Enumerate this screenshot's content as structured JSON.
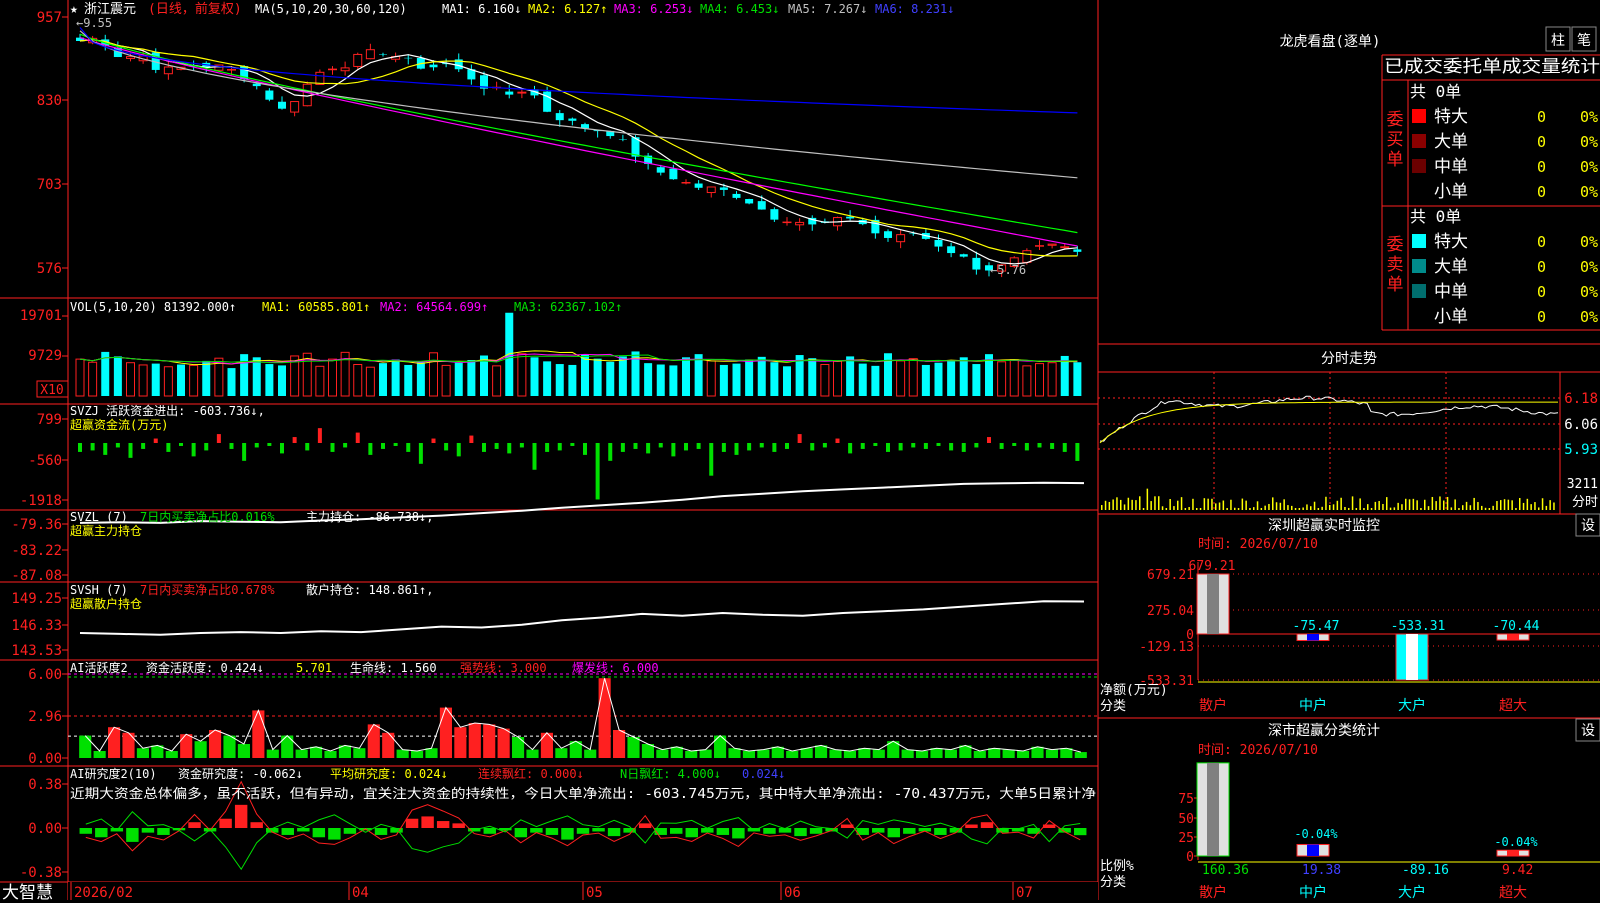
{
  "app": {
    "brand": "大智慧",
    "mode": "超赢"
  },
  "main_panel": {
    "star": "★",
    "stock": "浙江震元",
    "period": "(日线，前复权)",
    "ma_label": "MA(5,10,20,30,60,120)",
    "ma1": "MA1: 6.160↓",
    "ma2": "MA2: 6.127↑",
    "ma3": "MA3: 6.253↓",
    "ma4": "MA4: 6.453↓",
    "ma5": "MA5: 7.267↓",
    "ma6": "MA6: 8.231↓",
    "y_ticks": [
      "957",
      "830",
      "703",
      "576"
    ],
    "high_label": "←9.55",
    "low_label": "←5.76"
  },
  "vol_panel": {
    "title": "VOL(5,10,20)  81392.000↑",
    "ma1": "MA1: 60585.801↑",
    "ma2": "MA2: 64564.699↑",
    "ma3": "MA3: 62367.102↑",
    "y_ticks": [
      "19701",
      "9729"
    ],
    "unit": "X10"
  },
  "svzj_panel": {
    "title": "SVZJ  活跃资金进出: -603.736↓,",
    "subtitle": "超赢资金流(万元)",
    "y_ticks": [
      "799",
      "-560",
      "-1918"
    ]
  },
  "svzl_panel": {
    "title": "SVZL (7)",
    "ratio": "7日内买卖净占比0.016%",
    "hold": "主力持仓: -86.738↓,",
    "subtitle": "超赢主力持仓",
    "y_ticks": [
      "-79.36",
      "-83.22",
      "-87.08"
    ]
  },
  "svsh_panel": {
    "title": "SVSH (7)",
    "ratio": "7日内买卖净占比0.678%",
    "hold": "散户持仓: 148.861↑,",
    "subtitle": "超赢散户持仓",
    "y_ticks": [
      "149.25",
      "146.33",
      "143.53"
    ]
  },
  "ai_active_panel": {
    "title": "AI活跃度2",
    "v1": "资金活跃度: 0.424↓",
    "v2": "5.701",
    "v3": "生命线: 1.560",
    "v4": "强势线: 3.000",
    "v5": "爆发线: 6.000",
    "y_ticks": [
      "6.00",
      "2.96",
      "0.00"
    ]
  },
  "ai_research_panel": {
    "title": "AI研究度2(10)",
    "v1": "资金研究度: -0.062↓",
    "v2": "平均研究度: 0.024↓",
    "v3": "连续飘红: 0.000↓",
    "v4": "N日飘红: 4.000↓",
    "v5": "0.024↓",
    "comment": "近期大资金总体偏多，虽不活跃，但有异动，宜关注大资金的持续性，今日大单净流出: -603.745万元，其中特大单净流出: -70.437万元，大单5日累计净",
    "y_ticks": [
      "0.38",
      "0.00",
      "-0.38"
    ]
  },
  "x_axis": [
    "2026/02",
    "04",
    "05",
    "06",
    "07"
  ],
  "dragon_tiger": {
    "title": "龙虎看盘(逐单)",
    "btn_bar": "柱",
    "btn_stroke": "笔",
    "stats_title": "已成交委托单成交量统计",
    "buy_label": "委买单",
    "sell_label": "委卖单",
    "buy_total": "共 0单",
    "sell_total": "共 0单",
    "buy_rows": [
      {
        "name": "特大",
        "count": "0",
        "pct": "0%",
        "color": "#ff0000"
      },
      {
        "name": "大单",
        "count": "0",
        "pct": "0%",
        "color": "#8b0000"
      },
      {
        "name": "中单",
        "count": "0",
        "pct": "0%",
        "color": "#6b0000"
      },
      {
        "name": "小单",
        "count": "0",
        "pct": "0%",
        "color": ""
      }
    ],
    "sell_rows": [
      {
        "name": "特大",
        "count": "0",
        "pct": "0%",
        "color": "#00ffff"
      },
      {
        "name": "大单",
        "count": "0",
        "pct": "0%",
        "color": "#008b8b"
      },
      {
        "name": "中单",
        "count": "0",
        "pct": "0%",
        "color": "#006e6e"
      },
      {
        "name": "小单",
        "count": "0",
        "pct": "0%",
        "color": ""
      }
    ]
  },
  "intraday": {
    "title": "分时走势",
    "y_ticks": [
      "6.18",
      "6.06",
      "5.93"
    ],
    "vol_tick": "3211",
    "vol_unit": "分时"
  },
  "sz_monitor": {
    "title": "深圳超赢实时监控",
    "settings": "设",
    "time": "时间: 2026/07/10",
    "y_ticks": [
      "679.21",
      "275.04",
      "0",
      "-129.13",
      "-533.31"
    ],
    "axis_label": "净额(万元)",
    "axis_label2": "分类",
    "categories": [
      "散户",
      "中户",
      "大户",
      "超大"
    ],
    "values_text": [
      "679.21",
      "-75.47",
      "-533.31",
      "-70.44"
    ]
  },
  "sz_classify": {
    "title": "深市超赢分类统计",
    "settings": "设",
    "time": "时间: 2026/07/10",
    "y_ticks": [
      "75",
      "50",
      "25",
      "0"
    ],
    "axis_label": "比例%",
    "axis_label2": "分类",
    "categories": [
      "散户",
      "中户",
      "大户",
      "超大"
    ],
    "bar_labels": [
      "-0.04%",
      "-0.04%"
    ],
    "bottom_values": [
      "160.36",
      "19.38",
      "-89.16",
      "9.42"
    ]
  },
  "chart_data": [
    {
      "type": "candlestick",
      "title": "浙江震元(日线，前复权)",
      "ylim": [
        5.76,
        9.55
      ],
      "y_tick_labels": [
        "957",
        "830",
        "703",
        "576"
      ],
      "x_tick_labels": [
        "2026/02",
        "04",
        "05",
        "06",
        "07"
      ],
      "close_path": [
        9.3,
        9.35,
        9.05,
        9.1,
        8.85,
        8.9,
        8.95,
        8.9,
        8.8,
        8.55,
        8.25,
        8.6,
        8.9,
        8.95,
        9.1,
        9.15,
        9.0,
        8.9,
        8.95,
        8.8,
        8.6,
        8.5,
        8.6,
        8.25,
        8.1,
        8.0,
        7.95,
        7.7,
        7.4,
        7.3,
        7.15,
        7.1,
        7.05,
        6.9,
        6.7,
        6.65,
        6.55,
        6.6,
        6.7,
        6.45,
        6.35,
        6.45,
        6.3,
        6.15,
        5.95,
        5.9,
        6.05,
        6.2,
        6.25,
        6.15
      ],
      "ma_series": [
        {
          "name": "MA1",
          "value": 6.16,
          "color": "#ffffff"
        },
        {
          "name": "MA2",
          "value": 6.127,
          "color": "#ffff00"
        },
        {
          "name": "MA3",
          "value": 6.253,
          "color": "#ff00ff"
        },
        {
          "name": "MA4",
          "value": 6.453,
          "color": "#00ff00"
        },
        {
          "name": "MA5",
          "value": 7.267,
          "color": "#c0c0c0"
        },
        {
          "name": "MA6",
          "value": 8.231,
          "color": "#0000ff"
        }
      ]
    },
    {
      "type": "bar",
      "title": "VOL(5,10,20)",
      "ylim": [
        0,
        19701
      ],
      "values": [
        8200,
        7500,
        9800,
        8800,
        7400,
        6900,
        7200,
        6500,
        7000,
        6800,
        7800,
        8400,
        6200,
        9300,
        8600,
        7100,
        6800,
        8900,
        9500,
        6600,
        8200,
        9700,
        7000,
        6400,
        7300,
        8100,
        6900,
        7500,
        9600,
        6800,
        7400,
        8000,
        9000,
        6700,
        18500,
        9400,
        8600,
        7700,
        7100,
        6900,
        9200,
        8300,
        7600,
        8800,
        9900,
        7300,
        7000,
        6800,
        8600,
        9300,
        7800,
        6900,
        7200,
        8100,
        8700,
        7500,
        6600,
        9100,
        8400,
        7000,
        7700,
        8800,
        7200,
        6700,
        9500,
        7800,
        8300,
        6900,
        7400,
        8000,
        8600,
        7100,
        9300,
        7600,
        8100,
        6700,
        7200,
        7400,
        8900,
        7500
      ]
    },
    {
      "type": "bar",
      "title": "超赢资金流(万元)",
      "ylim": [
        -1918,
        799
      ],
      "values": [
        -300,
        -250,
        -400,
        -150,
        -500,
        -200,
        150,
        -300,
        -100,
        -450,
        -250,
        300,
        -200,
        -600,
        -150,
        -100,
        -350,
        200,
        -250,
        500,
        -300,
        -150,
        350,
        -400,
        -200,
        -100,
        -300,
        -700,
        150,
        -250,
        -450,
        250,
        -300,
        -200,
        -350,
        -150,
        -900,
        -300,
        -250,
        -100,
        -400,
        -1900,
        -600,
        -300,
        -200,
        -350,
        -150,
        -450,
        -250,
        -200,
        -1100,
        -300,
        -400,
        -250,
        -150,
        -300,
        -200,
        300,
        -250,
        -150,
        150,
        -350,
        -200,
        -100,
        -300,
        -250,
        -150,
        -200,
        -100,
        -250,
        -300,
        -150,
        200,
        -200,
        -100,
        -250,
        -150,
        -200,
        -300,
        -603.7
      ]
    },
    {
      "type": "line",
      "title": "超赢主力持仓",
      "ylim": [
        -87.08,
        -79.36
      ],
      "points": [
        -80.2,
        -80.3,
        -80.2,
        -80.5,
        -80.4,
        -80.3,
        -80.6,
        -80.8,
        -81.1,
        -81.4,
        -81.8,
        -82.2,
        -82.7,
        -83.1,
        -83.5,
        -84.0,
        -84.6,
        -85.0,
        -85.4,
        -85.7,
        -86.0,
        -86.3,
        -86.6,
        -86.7,
        -86.8,
        -86.74
      ]
    },
    {
      "type": "line",
      "title": "超赢散户持仓",
      "ylim": [
        143.53,
        149.25
      ],
      "points": [
        145.4,
        145.3,
        145.2,
        145.4,
        145.5,
        145.4,
        145.6,
        145.5,
        145.8,
        146.1,
        146.0,
        146.3,
        146.8,
        147.1,
        147.5,
        147.3,
        147.6,
        147.4,
        147.3,
        147.6,
        147.8,
        148.0,
        148.3,
        148.6,
        148.9,
        148.86
      ]
    },
    {
      "type": "bar",
      "title": "AI活跃度2",
      "ylim": [
        0,
        6
      ],
      "values": [
        1.6,
        0.5,
        2.2,
        1.8,
        0.7,
        0.9,
        0.5,
        1.7,
        1.2,
        2.0,
        1.6,
        1.0,
        3.4,
        0.6,
        1.6,
        0.6,
        0.8,
        0.5,
        0.9,
        0.7,
        2.4,
        1.8,
        0.6,
        0.5,
        0.7,
        3.6,
        2.2,
        2.5,
        2.4,
        2.1,
        1.5,
        0.6,
        1.8,
        0.7,
        1.2,
        0.6,
        5.7,
        2.0,
        1.5,
        1.0,
        0.6,
        0.8,
        0.5,
        0.6,
        1.6,
        0.7,
        0.5,
        0.6,
        0.8,
        0.5,
        0.7,
        0.9,
        0.6,
        0.5,
        0.7,
        0.6,
        1.2,
        0.6,
        0.5,
        0.7,
        0.6,
        0.9,
        0.5,
        0.7,
        0.6,
        0.5,
        0.8,
        0.6,
        0.7,
        0.424
      ]
    },
    {
      "type": "bar",
      "title": "AI研究度2(10)",
      "ylim": [
        -0.38,
        0.38
      ],
      "values": [
        -0.05,
        -0.08,
        -0.03,
        -0.12,
        -0.04,
        -0.06,
        -0.02,
        0.05,
        -0.03,
        0.08,
        0.2,
        0.05,
        -0.04,
        -0.06,
        -0.03,
        -0.08,
        -0.1,
        -0.05,
        -0.02,
        -0.06,
        -0.04,
        0.08,
        0.1,
        0.06,
        0.04,
        -0.03,
        -0.05,
        -0.02,
        -0.08,
        -0.04,
        -0.06,
        -0.1,
        -0.05,
        -0.03,
        -0.07,
        -0.04,
        0.04,
        -0.06,
        -0.05,
        -0.08,
        -0.04,
        -0.06,
        -0.09,
        -0.03,
        -0.05,
        -0.04,
        -0.07,
        -0.05,
        -0.03,
        0.03,
        -0.06,
        -0.04,
        -0.08,
        -0.05,
        -0.03,
        -0.06,
        -0.04,
        0.03,
        0.05,
        -0.04,
        -0.03,
        -0.05,
        0.03,
        -0.04,
        -0.062
      ]
    },
    {
      "type": "bar",
      "title": "深圳超赢实时监控",
      "categories": [
        "散户",
        "中户",
        "大户",
        "超大"
      ],
      "values": [
        679.21,
        -75.47,
        -533.31,
        -70.44
      ],
      "ylim": [
        -533.31,
        679.21
      ]
    },
    {
      "type": "bar",
      "title": "深市超赢分类统计",
      "categories": [
        "散户",
        "中户",
        "大户",
        "超大"
      ],
      "values": [
        97,
        12,
        0,
        6
      ],
      "ylim": [
        0,
        100
      ]
    }
  ]
}
